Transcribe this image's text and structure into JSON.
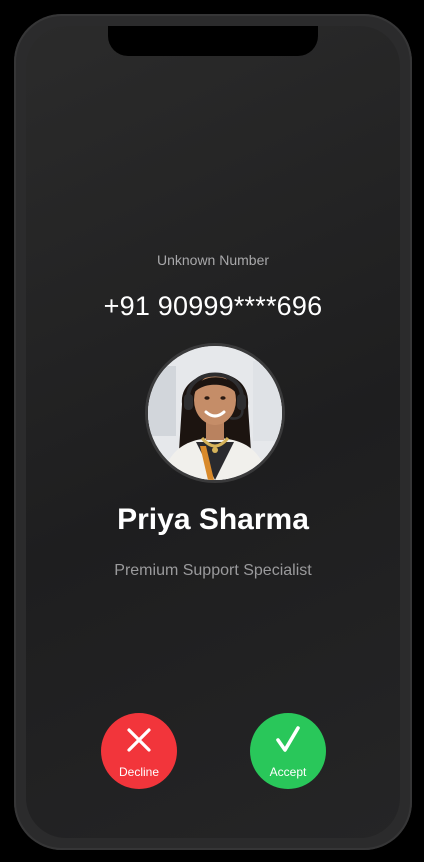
{
  "call": {
    "label": "Unknown Number",
    "number": "+91 90999****696",
    "caller_name": "Priya Sharma",
    "caller_title": "Premium Support Specialist"
  },
  "actions": {
    "decline_label": "Decline",
    "accept_label": "Accept"
  },
  "icons": {
    "decline": "close-icon",
    "accept": "checkmark-icon"
  },
  "colors": {
    "decline": "#f2353b",
    "accept": "#29c75a",
    "background": "#232324"
  }
}
